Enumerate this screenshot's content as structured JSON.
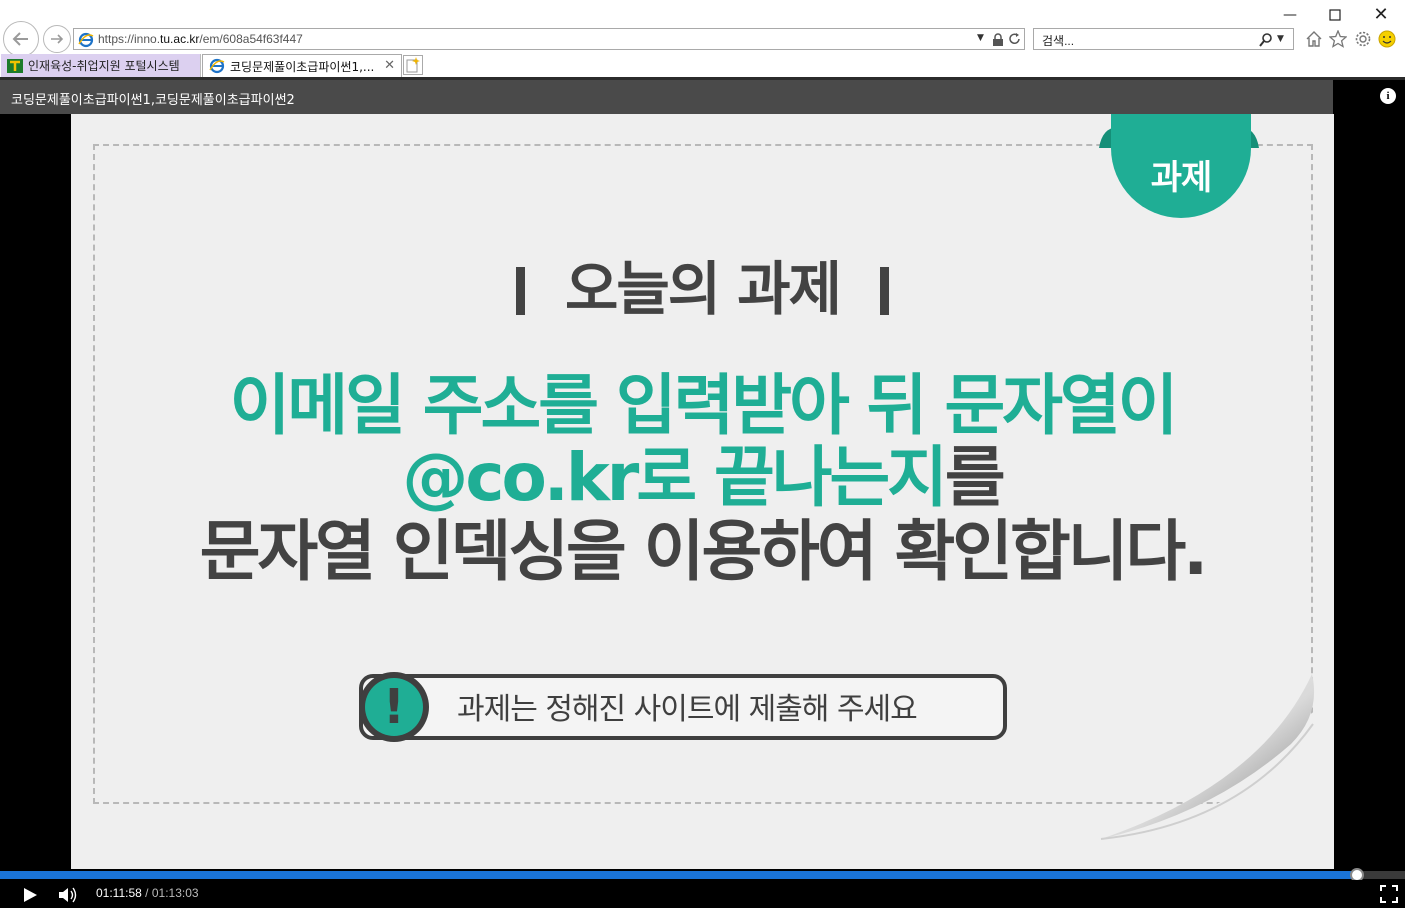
{
  "browser": {
    "url_prefix": "https://inno.",
    "url_domain": "tu.ac.kr",
    "url_path": "/em/608a54f63f447",
    "search_placeholder": "검색...",
    "tabs": [
      {
        "label": "인재육성-취업지원 포털시스템",
        "active": false
      },
      {
        "label": "코딩문제풀이초급파이썬1,...",
        "active": true
      }
    ],
    "close_glyph": "✕"
  },
  "player": {
    "title": "코딩문제풀이초급파이썬1,코딩문제풀이초급파이썬2",
    "current_time": "01:11:58",
    "separator": "/",
    "duration": "01:13:03",
    "progress": 0.985
  },
  "slide": {
    "tag": "과제",
    "heading": "오늘의 과제",
    "line1": "이메일 주소를 입력받아 뒤 문자열이",
    "line2_green": "@co.kr로 끝나는지",
    "line2_dark": "를",
    "line3": "문자열 인덱싱을 이용하여 확인합니다.",
    "notice": "과제는 정해진 사이트에 제출해 주세요",
    "notice_icon": "!"
  },
  "colors": {
    "accent": "#1fae95",
    "text_dark": "#434343",
    "progress": "#1a74d8"
  }
}
